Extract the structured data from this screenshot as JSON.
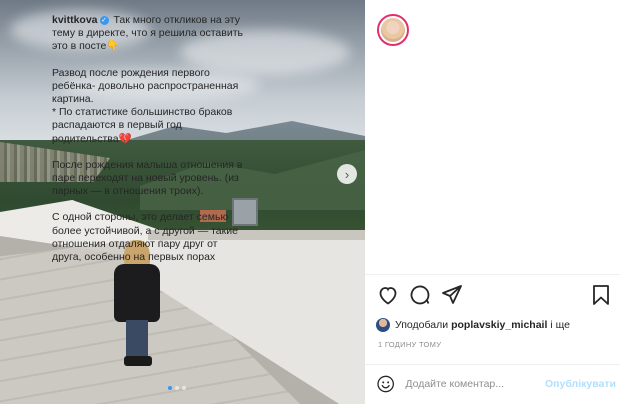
{
  "post": {
    "username": "kvittkova",
    "caption_intro": "Так много откликов на эту тему в директе, что я решила оставить это в посте👇",
    "paragraphs": [
      "Развод после рождения первого ребёнка- довольно распространенная картина.\n* По статистике большинство браков распадаются в первый год родительства💔",
      "После рождения малыша отношения в паре переходят на новый уровень. (из парных — в отношения троих).",
      "С одной стороны, это делает семью более устойчивой, а с другой — такие отношения отдаляют пару друг от друга, особенно на первых порах"
    ]
  },
  "likes": {
    "prefix": "Уподобали",
    "user": "poplavskiy_michail",
    "suffix": "і ще"
  },
  "timestamp": "1 ГОДИНУ ТОМУ",
  "comment": {
    "placeholder": "Додайте коментар...",
    "post_label": "Опублікувати"
  },
  "carousel": {
    "current": 1,
    "total": 3
  },
  "colors": {
    "verified": "#3897f0",
    "like_ring": "#e1306c",
    "post_button": "#b2dffc"
  },
  "icons": [
    "heart-icon",
    "comment-icon",
    "share-icon",
    "bookmark-icon",
    "emoji-icon",
    "chevron-right-icon",
    "verified-icon"
  ]
}
